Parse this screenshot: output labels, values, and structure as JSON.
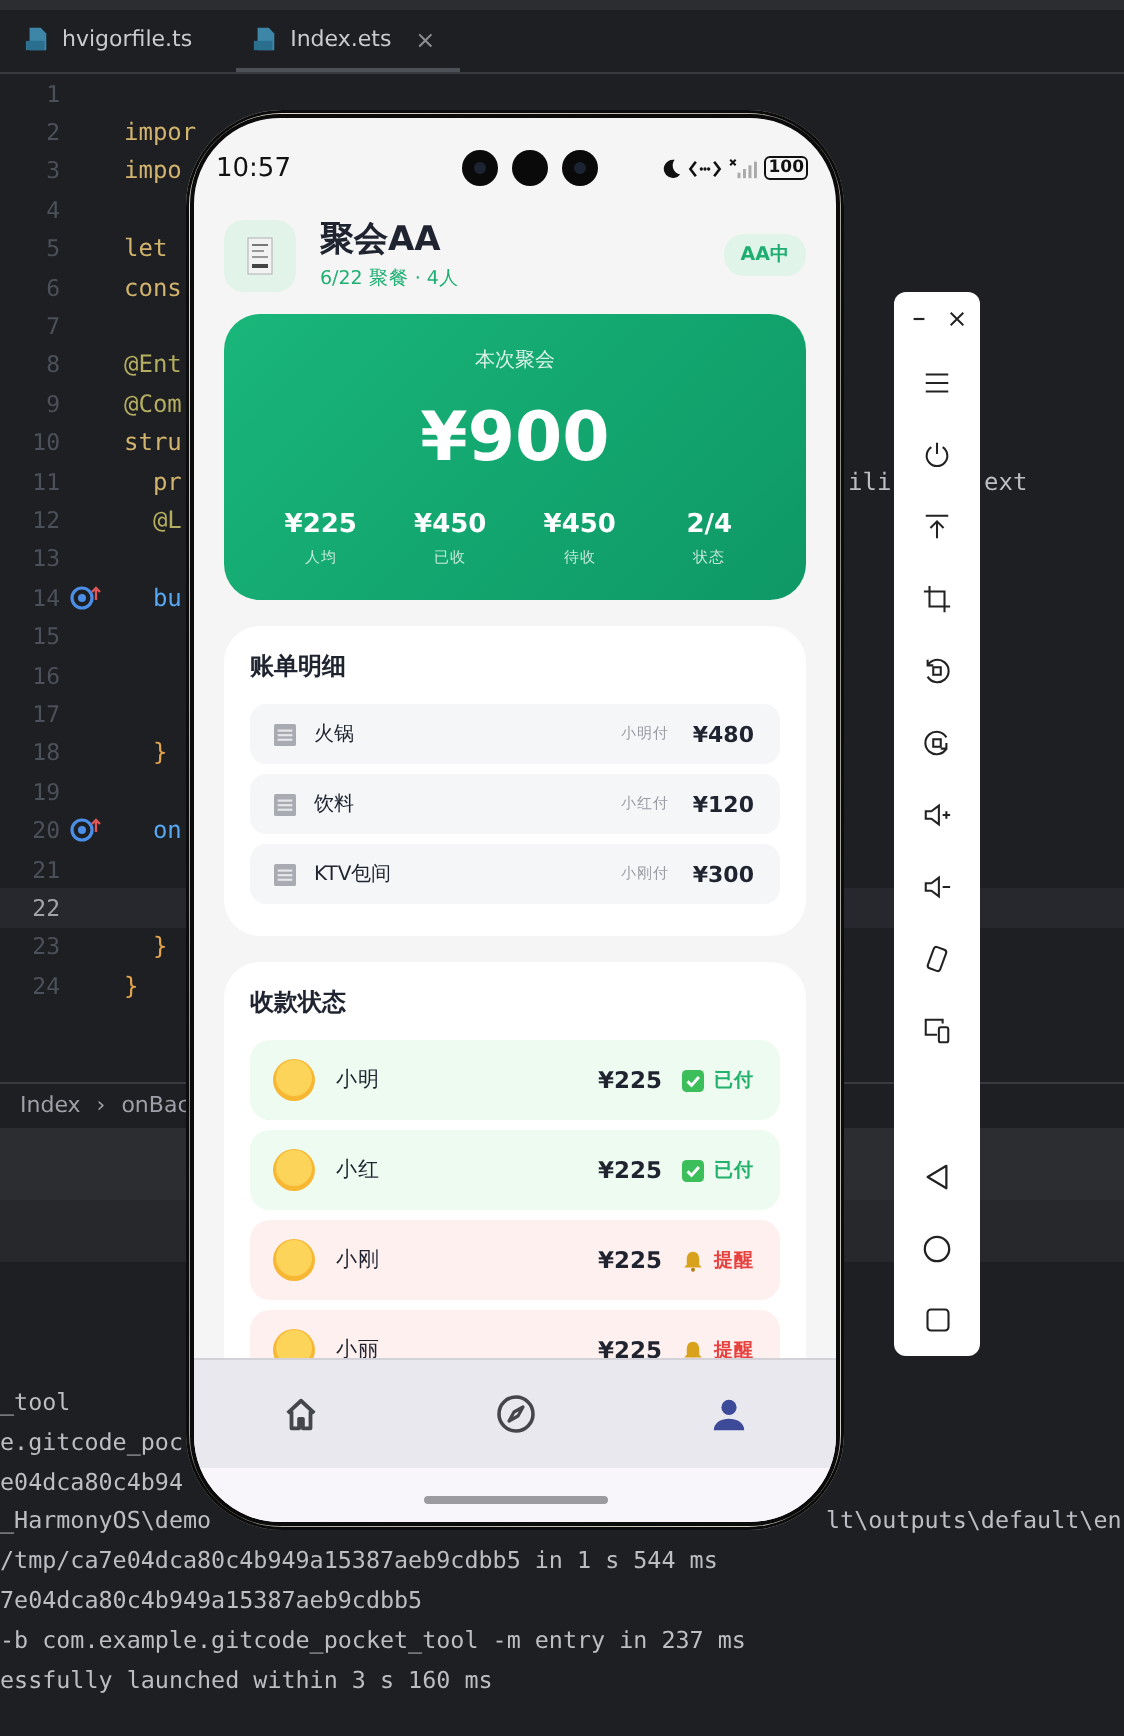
{
  "editor": {
    "tabs": [
      {
        "label": "hvigorfile.ts",
        "selected": false
      },
      {
        "label": "Index.ets",
        "selected": true,
        "close": "×"
      }
    ],
    "lines": [
      {
        "number": "1",
        "current": false,
        "marker": false
      },
      {
        "number": "2",
        "code": "impor",
        "kind": "keyword",
        "current": false,
        "marker": false
      },
      {
        "number": "3",
        "code": "impo",
        "kind": "keyword",
        "current": false,
        "marker": false
      },
      {
        "number": "4",
        "current": false,
        "marker": false
      },
      {
        "number": "5",
        "code": "let",
        "kind": "keyword",
        "current": false,
        "marker": false
      },
      {
        "number": "6",
        "code": "cons",
        "kind": "keyword",
        "current": false,
        "marker": false
      },
      {
        "number": "7",
        "current": false,
        "marker": false
      },
      {
        "number": "8",
        "code": "@Ent",
        "kind": "annotation",
        "current": false,
        "marker": false
      },
      {
        "number": "9",
        "code": "@Com",
        "kind": "annotation",
        "current": false,
        "marker": false
      },
      {
        "number": "10",
        "code": "stru",
        "kind": "keyword",
        "current": false,
        "marker": false
      },
      {
        "number": "11",
        "code": "  pr",
        "kind": "keyword",
        "tail": [
          "ili",
          "ext"
        ],
        "current": false,
        "marker": false
      },
      {
        "number": "12",
        "code": "  @L",
        "kind": "annotation",
        "current": false,
        "marker": false
      },
      {
        "number": "13",
        "current": false,
        "marker": false
      },
      {
        "number": "14",
        "code": "  bu",
        "kind": "method",
        "current": false,
        "marker": true
      },
      {
        "number": "15",
        "current": false,
        "marker": false
      },
      {
        "number": "16",
        "current": false,
        "marker": false
      },
      {
        "number": "17",
        "current": false,
        "marker": false
      },
      {
        "number": "18",
        "code": "  }",
        "kind": "brace",
        "current": false,
        "marker": false
      },
      {
        "number": "19",
        "current": false,
        "marker": false
      },
      {
        "number": "20",
        "code": "  on",
        "kind": "method",
        "current": false,
        "marker": true
      },
      {
        "number": "21",
        "current": false,
        "marker": false
      },
      {
        "number": "22",
        "current": true,
        "marker": false
      },
      {
        "number": "23",
        "code": "  }",
        "kind": "brace",
        "current": false,
        "marker": false
      },
      {
        "number": "24",
        "code": "}",
        "kind": "brace",
        "current": false,
        "marker": false
      }
    ],
    "breadcrumb": {
      "items": [
        "Index",
        "onBac"
      ],
      "separator": "›"
    }
  },
  "console": {
    "lines": [
      {
        "text": "_tool"
      },
      {
        "text": "e.gitcode_poc"
      },
      {
        "text": "e04dca80c4b94"
      },
      {
        "text": "_HarmonyOS\\demo",
        "right": "lt\\outputs\\default\\en"
      },
      {
        "text": "/tmp/ca7e04dca80c4b949a15387aeb9cdbb5 in 1 s 544 ms"
      },
      {
        "text": "7e04dca80c4b949a15387aeb9cdbb5"
      },
      {
        "text": "-b com.example.gitcode_pocket_tool -m entry in 237 ms"
      },
      {
        "text": "essfully launched within 3 s 160 ms"
      }
    ]
  },
  "phone": {
    "status_bar": {
      "time": "10:57",
      "battery": "100"
    },
    "header": {
      "title": "聚会AA",
      "subtitle": "6/22 聚餐 · 4人",
      "badge": "AA中"
    },
    "summary": {
      "label": "本次聚会",
      "total": "¥900",
      "stats": [
        {
          "value": "¥225",
          "label": "人均"
        },
        {
          "value": "¥450",
          "label": "已收"
        },
        {
          "value": "¥450",
          "label": "待收"
        },
        {
          "value": "2/4",
          "label": "状态"
        }
      ]
    },
    "bill": {
      "title": "账单明细",
      "items": [
        {
          "name": "火锅",
          "payer": "小明付",
          "amount": "¥480"
        },
        {
          "name": "饮料",
          "payer": "小红付",
          "amount": "¥120"
        },
        {
          "name": "KTV包间",
          "payer": "小刚付",
          "amount": "¥300"
        }
      ]
    },
    "payments": {
      "title": "收款状态",
      "rows": [
        {
          "name": "小明",
          "amount": "¥225",
          "paid": true,
          "status": "已付"
        },
        {
          "name": "小红",
          "amount": "¥225",
          "paid": true,
          "status": "已付"
        },
        {
          "name": "小刚",
          "amount": "¥225",
          "paid": false,
          "status": "提醒"
        },
        {
          "name": "小丽",
          "amount": "¥225",
          "paid": false,
          "status": "提醒"
        }
      ]
    },
    "nav": [
      {
        "kind": "home",
        "selected": false
      },
      {
        "kind": "compass",
        "selected": false
      },
      {
        "kind": "person",
        "selected": true
      }
    ]
  }
}
